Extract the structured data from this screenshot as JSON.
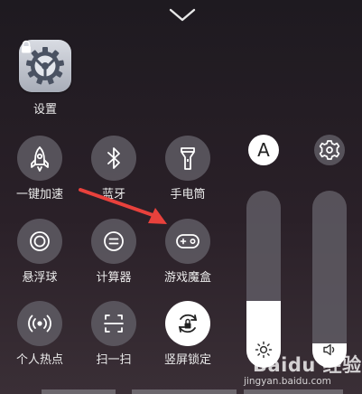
{
  "header": {
    "collapse_icon": "chevron-down-icon"
  },
  "apps": [
    {
      "label": "设置",
      "icon": "settings-gear-icon",
      "badge_icon": "lock-icon"
    }
  ],
  "tiles": [
    {
      "label": "一键加速",
      "icon": "rocket-icon",
      "active": false
    },
    {
      "label": "蓝牙",
      "icon": "bluetooth-icon",
      "active": false
    },
    {
      "label": "手电筒",
      "icon": "flashlight-icon",
      "active": false
    },
    {
      "label": "悬浮球",
      "icon": "floating-ball-icon",
      "active": false
    },
    {
      "label": "计算器",
      "icon": "calculator-icon",
      "active": false
    },
    {
      "label": "游戏魔盒",
      "icon": "gamepad-icon",
      "active": false
    },
    {
      "label": "个人热点",
      "icon": "hotspot-icon",
      "active": false
    },
    {
      "label": "扫一扫",
      "icon": "scan-icon",
      "active": false
    },
    {
      "label": "竖屏锁定",
      "icon": "rotation-lock-icon",
      "active": true
    }
  ],
  "auto_brightness": {
    "label": "A",
    "active": true
  },
  "settings_button": {
    "icon": "gear-icon"
  },
  "sliders": {
    "brightness": {
      "icon": "sun-icon",
      "level": 0.38
    },
    "volume": {
      "icon": "speaker-icon",
      "level": 0.14
    }
  },
  "watermark": {
    "main": "Baidu 经验",
    "sub": "jingyan.baidu.com"
  },
  "colors": {
    "tile_bg": "#5f5c64",
    "active_bg": "#ffffff",
    "arrow": "#e8413c"
  }
}
